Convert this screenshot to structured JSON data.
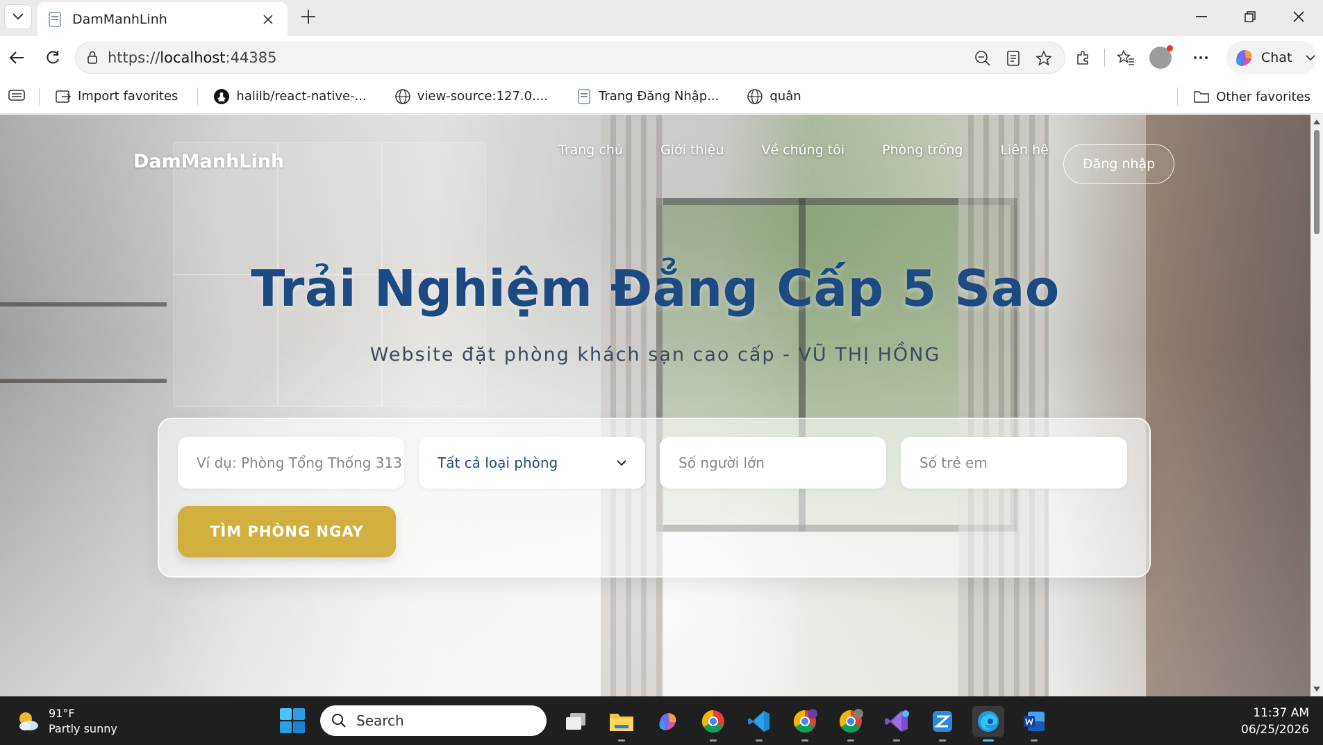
{
  "browser": {
    "tab_title": "DamManhLinh",
    "url_scheme": "https://",
    "url_host": "localhost",
    "url_port": ":44385",
    "chat_label": "Chat"
  },
  "bookmarks": {
    "items": [
      {
        "label": "Import favorites",
        "icon": "import-icon"
      },
      {
        "label": "halilb/react-native-...",
        "icon": "github-icon"
      },
      {
        "label": "view-source:127.0....",
        "icon": "globe-icon"
      },
      {
        "label": "Trang Đăng Nhập...",
        "icon": "page-icon"
      },
      {
        "label": "quân",
        "icon": "globe-icon"
      }
    ],
    "other_favorites": "Other favorites"
  },
  "site": {
    "logo": "DamManhLinh",
    "nav": [
      "Trang chủ",
      "Giới thiệu",
      "Về chúng tôi",
      "Phòng trống",
      "Liên hệ"
    ],
    "login": "Đăng nhập"
  },
  "hero": {
    "title": "Trải Nghiệm Đẳng Cấp 5 Sao",
    "subtitle": "Website đặt phòng khách sạn cao cấp - VŨ THỊ HỒNG"
  },
  "search": {
    "room_name_placeholder": "Ví dụ: Phòng Tổng Thống 313",
    "room_type_selected": "Tất cả loại phòng",
    "adults_placeholder": "Số người lớn",
    "children_placeholder": "Số trẻ em",
    "submit": "TÌM PHÒNG NGAY"
  },
  "taskbar": {
    "weather_temp": "91°F",
    "weather_desc": "Partly sunny",
    "search_label": "Search",
    "time": "11:37 AM",
    "date": "06/25/2026"
  },
  "colors": {
    "title_blue": "#1d4a83",
    "button_gold": "#d1b03f"
  }
}
